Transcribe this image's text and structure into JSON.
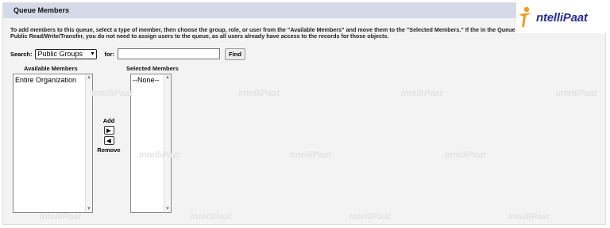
{
  "section": {
    "title": "Queue Members"
  },
  "instructions": "To add members to this queue, select a type of member, then choose the group, role, or user from the \"Available Members\" and move them to the \"Selected Members.\" If the in the Queue is Public Read/Write/Transfer, you do not need to assign users to the queue, as all users already have access to the records for those objects.",
  "logo": {
    "text": "ntelliPaat",
    "mark": "I"
  },
  "search": {
    "label": "Search:",
    "selected": "Public Groups",
    "for_label": "for:",
    "for_value": "",
    "find_label": "Find"
  },
  "available": {
    "label": "Available Members",
    "items": [
      "Entire Organization"
    ]
  },
  "selected_members": {
    "label": "Selected Members",
    "items": [
      "--None--"
    ]
  },
  "controls": {
    "add_label": "Add",
    "remove_label": "Remove",
    "add_icon": "arrow-right-icon",
    "remove_icon": "arrow-left-icon"
  },
  "watermark": "IntelliPaat"
}
